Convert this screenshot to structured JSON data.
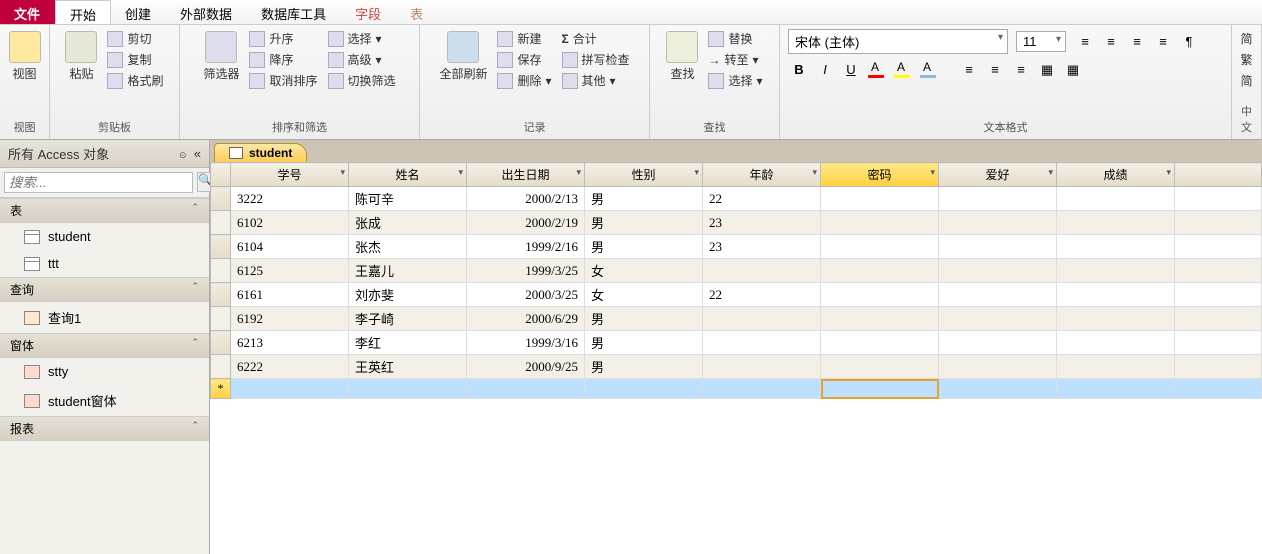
{
  "tabs": {
    "file": "文件",
    "home": "开始",
    "create": "创建",
    "external": "外部数据",
    "dbtools": "数据库工具",
    "fields": "字段",
    "table": "表"
  },
  "ribbon": {
    "view": {
      "label": "视图",
      "group": "视图"
    },
    "clipboard": {
      "paste": "粘贴",
      "cut": "剪切",
      "copy": "复制",
      "painter": "格式刷",
      "group": "剪贴板"
    },
    "sort": {
      "filter": "筛选器",
      "asc": "升序",
      "desc": "降序",
      "clear": "取消排序",
      "selection": "选择",
      "advanced": "高级",
      "toggle": "切换筛选",
      "group": "排序和筛选"
    },
    "records": {
      "refresh": "全部刷新",
      "new": "新建",
      "save": "保存",
      "delete": "删除",
      "totals": "合计",
      "spell": "拼写检查",
      "more": "其他",
      "group": "记录"
    },
    "find": {
      "find": "查找",
      "replace": "替换",
      "goto": "转至",
      "select": "选择",
      "group": "查找"
    },
    "format": {
      "font": "宋体 (主体)",
      "size": "11",
      "group": "文本格式"
    },
    "cjk": {
      "s": "简",
      "t": "繁",
      "h": "简",
      "group": "中文"
    }
  },
  "nav": {
    "title": "所有 Access 对象",
    "search_ph": "搜索...",
    "cats": {
      "tables": "表",
      "queries": "查询",
      "forms": "窗体",
      "reports": "报表"
    },
    "tables": [
      "student",
      "ttt"
    ],
    "queries": [
      "查询1"
    ],
    "forms": [
      "stty",
      "student窗体"
    ]
  },
  "sheet": {
    "tabname": "student",
    "columns": [
      "学号",
      "姓名",
      "出生日期",
      "性别",
      "年龄",
      "密码",
      "爱好",
      "成绩"
    ],
    "highlight_col": 5,
    "rows": [
      [
        "3222",
        "陈可辛",
        "2000/2/13",
        "男",
        "22",
        "",
        "",
        ""
      ],
      [
        "6102",
        "张成",
        "2000/2/19",
        "男",
        "23",
        "",
        "",
        ""
      ],
      [
        "6104",
        "张杰",
        "1999/2/16",
        "男",
        "23",
        "",
        "",
        ""
      ],
      [
        "6125",
        "王嘉儿",
        "1999/3/25",
        "女",
        "",
        "",
        "",
        ""
      ],
      [
        "6161",
        "刘亦斐",
        "2000/3/25",
        "女",
        "22",
        "",
        "",
        ""
      ],
      [
        "6192",
        "李子崎",
        "2000/6/29",
        "男",
        "",
        "",
        "",
        ""
      ],
      [
        "6213",
        "李红",
        "1999/3/16",
        "男",
        "",
        "",
        "",
        ""
      ],
      [
        "6222",
        "王英红",
        "2000/9/25",
        "男",
        "",
        "",
        "",
        ""
      ]
    ]
  }
}
